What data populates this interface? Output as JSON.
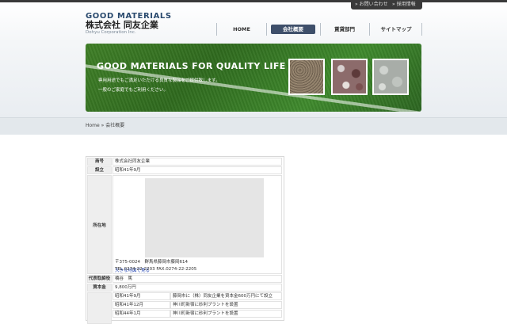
{
  "header": {
    "logo_en": "GOOD MATERIALS",
    "logo_jp": "株式会社 同友企業",
    "logo_sub": "Dohyu Corporation Inc.",
    "util_links": [
      "» お問い合わせ",
      "» 採用情報"
    ]
  },
  "nav": [
    {
      "label": "HOME",
      "active": false
    },
    {
      "label": "会社概要",
      "active": true
    },
    {
      "label": "賃貸部門",
      "active": false
    },
    {
      "label": "サイトマップ",
      "active": false
    }
  ],
  "banner": {
    "title": "GOOD MATERIALS FOR QUALITY LIFE",
    "lines": [
      "専用用途でもご満足いただける良質な製品をご提供致します。",
      "一般のご家庭でもご利用ください。"
    ]
  },
  "breadcrumb": {
    "home": "Home",
    "sep": " » ",
    "current": "会社概要"
  },
  "company": {
    "name_label": "商号",
    "name": "株式会社同友企業",
    "founded_label": "設立",
    "founded": "昭和41年9月",
    "address_label": "所在地",
    "map_link": "大きな地図で見る",
    "postal": "〒375-0024　群馬県藤岡市藤岡614",
    "tel": "TEL.0274-22-2203 FAX.0274-22-2205",
    "ceo_label": "代表取締役",
    "ceo": "橋谷　篤",
    "capital_label": "資本金",
    "capital": "9,800万円",
    "history": [
      {
        "date": "昭和41年9月",
        "desc": "藤岡市に（株）同友企業を資本金600万円にて設立"
      },
      {
        "date": "昭和41年12月",
        "desc": "神川町新宿に砂利プラントを設置"
      },
      {
        "date": "昭和44年1月",
        "desc": "神川町新宿に砂利プラントを設置"
      }
    ]
  },
  "colors": {
    "nav_active": "#3e4f6a",
    "logo_blue": "#2a4a6e",
    "link_blue": "#2a4bb5"
  }
}
